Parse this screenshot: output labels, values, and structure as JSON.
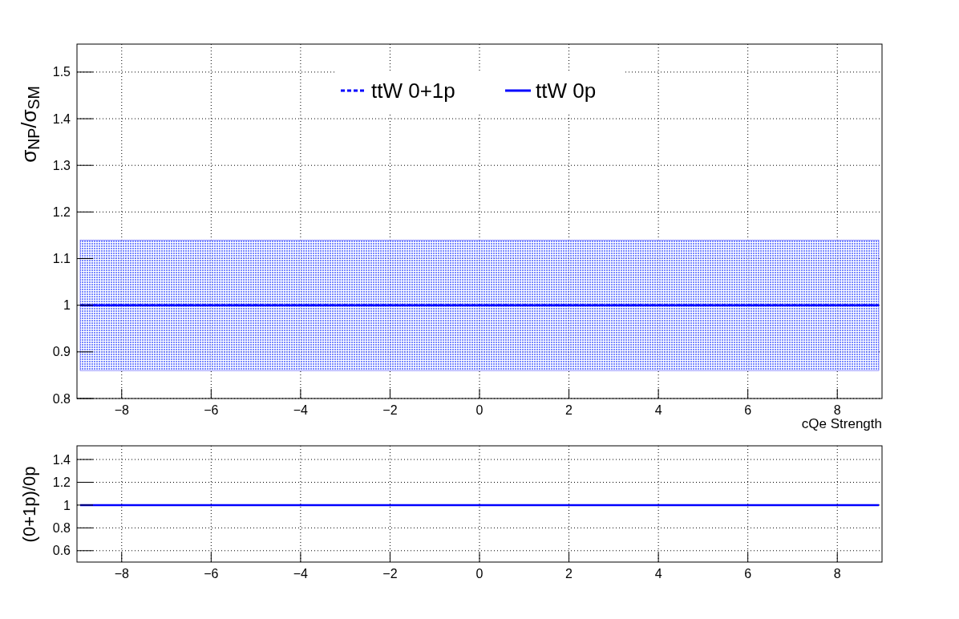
{
  "main_plot": {
    "chart_data": {
      "type": "line",
      "ylabel": "σ$_{NP}$/σ$_{SM}$",
      "xlabel": "cQe Strength",
      "x": [
        -9,
        9
      ],
      "series": [
        {
          "name": "ttW 0+1p",
          "color": "#0000ff",
          "line_style": "dashed",
          "values": [
            1,
            1
          ]
        },
        {
          "name": "ttW 0p",
          "color": "#0000ff",
          "line_style": "solid",
          "values": [
            1,
            1
          ]
        }
      ],
      "xlim": [
        -9,
        9
      ],
      "ylim": [
        0.8,
        1.56
      ],
      "xticks": [
        {
          "value": -8,
          "label": "−8"
        },
        {
          "value": -6,
          "label": "−6"
        },
        {
          "value": -4,
          "label": "−4"
        },
        {
          "value": -2,
          "label": "−2"
        },
        {
          "value": 0,
          "label": "0"
        },
        {
          "value": 2,
          "label": "2"
        },
        {
          "value": 4,
          "label": "4"
        },
        {
          "value": 6,
          "label": "6"
        },
        {
          "value": 8,
          "label": "8"
        }
      ],
      "yticks": [
        0.8,
        0.9,
        1,
        1.1,
        1.2,
        1.3,
        1.4,
        1.5
      ],
      "grid": true,
      "legend": true,
      "bands": [
        {
          "axis": "y",
          "from": 0.86,
          "to": 1.14,
          "color": "#0000ff"
        }
      ]
    }
  },
  "ratio_plot": {
    "chart_data": {
      "type": "line",
      "ylabel": "(0+1p)/0p",
      "x": [
        -9,
        9
      ],
      "series": [
        {
          "color": "#0000ff",
          "line_style": "solid",
          "values": [
            1,
            1
          ]
        }
      ],
      "xlim": [
        -9,
        9
      ],
      "ylim": [
        0.5,
        1.52
      ],
      "xticks": [
        {
          "value": -8,
          "label": "−8"
        },
        {
          "value": -6,
          "label": "−6"
        },
        {
          "value": -4,
          "label": "−4"
        },
        {
          "value": -2,
          "label": "−2"
        },
        {
          "value": 0,
          "label": "0"
        },
        {
          "value": 2,
          "label": "2"
        },
        {
          "value": 4,
          "label": "4"
        },
        {
          "value": 6,
          "label": "6"
        },
        {
          "value": 8,
          "label": "8"
        }
      ],
      "yticks": [
        0.6,
        0.8,
        1,
        1.2,
        1.4
      ],
      "grid": true
    }
  }
}
